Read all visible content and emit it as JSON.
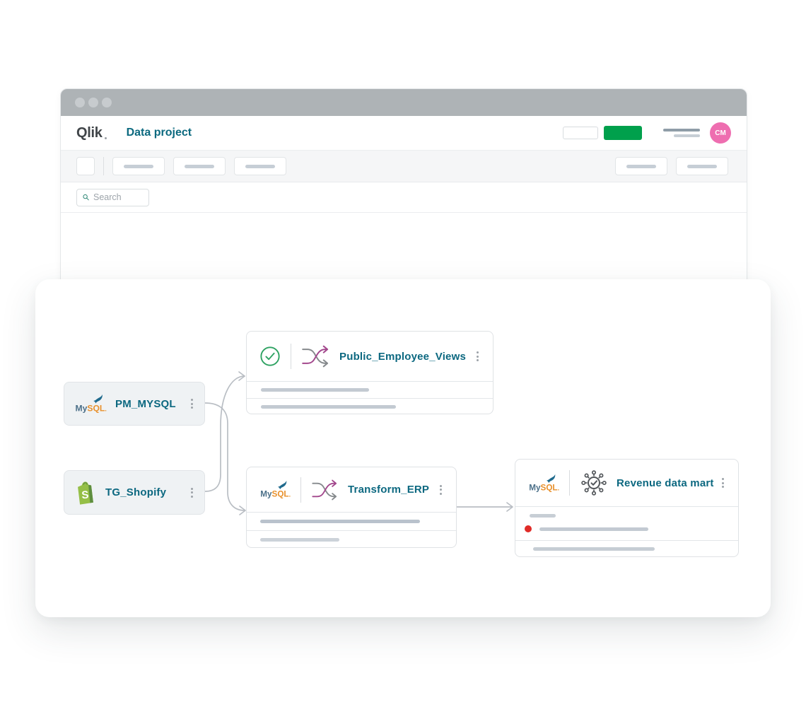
{
  "browser": {
    "logo": "Qlik",
    "title": "Data project",
    "search": {
      "placeholder": "Search"
    },
    "avatar": {
      "initials": "CM"
    }
  },
  "nodes": {
    "pm_mysql": {
      "label": "PM_MYSQL",
      "connector": "mysql"
    },
    "tg_shopify": {
      "label": "TG_Shopify",
      "connector": "shopify"
    },
    "public_employee_views": {
      "label": "Public_Employee_Views",
      "type": "transform",
      "status": "success"
    },
    "transform_erp": {
      "label": "Transform_ERP",
      "type": "transform",
      "connector": "mysql"
    },
    "revenue_data_mart": {
      "label": "Revenue data mart",
      "type": "data-mart",
      "connector": "mysql",
      "alert": true
    }
  },
  "colors": {
    "brand_green": "#00A04C",
    "accent_teal": "#0C6880",
    "avatar_pink": "#EE6EB0",
    "status_green": "#2EA262",
    "alert_red": "#E02B27",
    "connector_gray": "#B9BEC4",
    "shuffle_magenta": "#A2478C",
    "chrome_gray": "#AEB3B6"
  }
}
